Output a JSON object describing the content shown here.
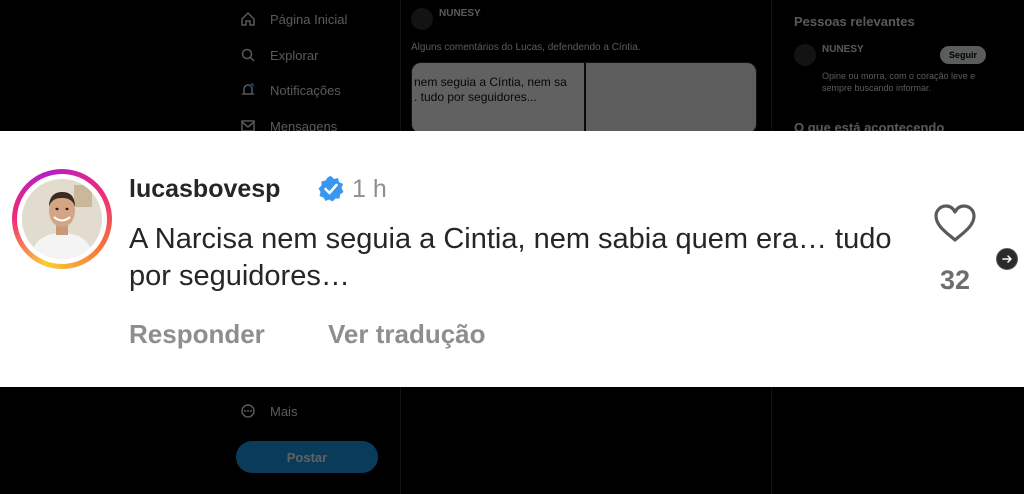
{
  "background": {
    "nav": {
      "items": [
        {
          "label": "Página Inicial",
          "icon": "home-icon"
        },
        {
          "label": "Explorar",
          "icon": "search-icon"
        },
        {
          "label": "Notificações",
          "icon": "bell-icon"
        },
        {
          "label": "Mensagens",
          "icon": "mail-icon"
        },
        {
          "label": "Mais",
          "icon": "more-icon"
        }
      ],
      "post_label": "Postar"
    },
    "tweet": {
      "user": "NUNESY",
      "text": "Alguns comentários do Lucas, defendendo a Cíntia.",
      "media_text": "nem seguia a Cíntia, nem sa\n. tudo por seguidores..."
    },
    "right": {
      "relevant_title": "Pessoas relevantes",
      "user": "NUNESY",
      "follow_label": "Seguir",
      "bio": "Opine ou morra, com o coração leve e sempre buscando informar.",
      "trending_title": "O que está acontecendo"
    }
  },
  "comment": {
    "username": "lucasbovesp",
    "time": "1 h",
    "text": "A Narcisa nem seguia a Cintia, nem sabia quem era… tudo por seguidores…",
    "reply_label": "Responder",
    "translate_label": "Ver tradução",
    "likes": "32"
  },
  "colors": {
    "verified": "#3897f0",
    "secondary_text": "#8e8e8e",
    "primary_text": "#262626",
    "card_bg": "#ffffff",
    "page_bg": "#000000"
  }
}
